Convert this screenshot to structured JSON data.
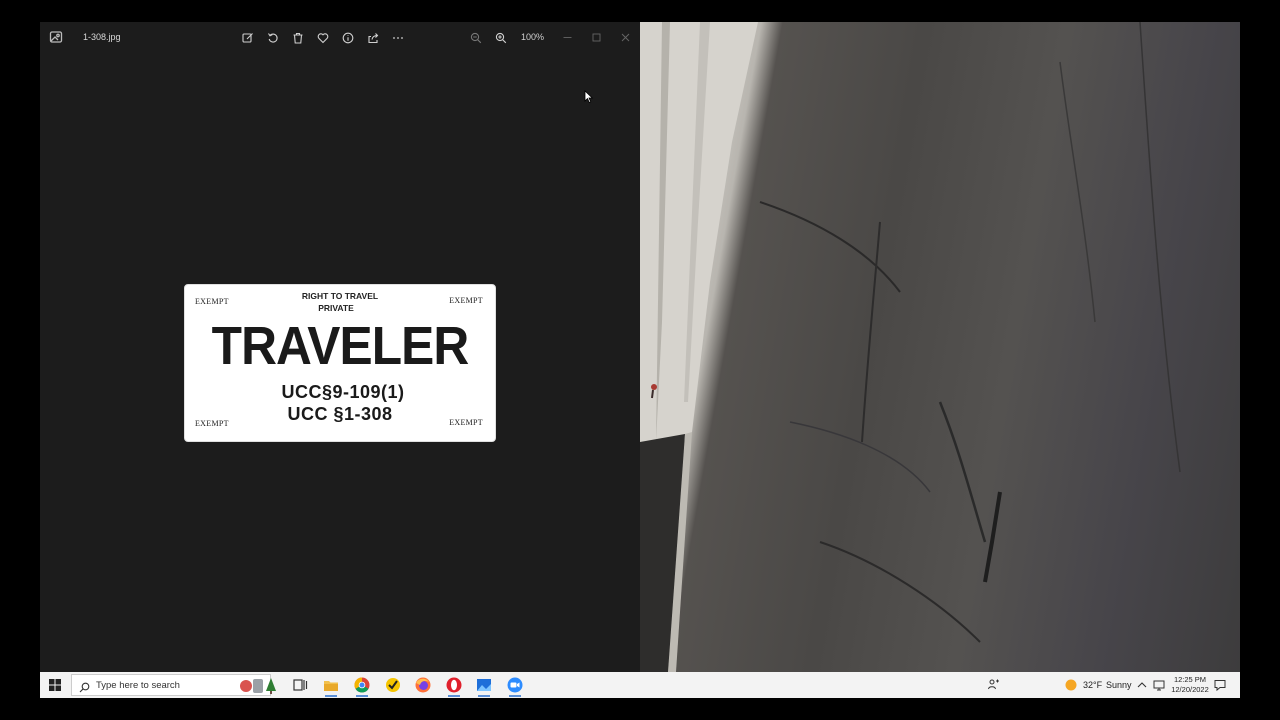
{
  "viewer": {
    "file_name": "1-308.jpg",
    "zoom_level": "100%"
  },
  "plate": {
    "exempt_top_left": "EXEMPT",
    "exempt_top_right": "EXEMPT",
    "exempt_bottom_left": "EXEMPT",
    "exempt_bottom_right": "EXEMPT",
    "line1": "RIGHT TO TRAVEL",
    "line2": "PRIVATE",
    "main": "TRAVELER",
    "code1": "UCC§9-109(1)",
    "code2": "UCC §1-308"
  },
  "taskbar": {
    "search_placeholder": "Type here to search",
    "weather_temp": "32°F",
    "weather_desc": "Sunny",
    "time": "12:25 PM",
    "date": "12/20/2022"
  },
  "colors": {
    "viewer_bg": "#1c1c1c",
    "taskbar_bg": "#f3f3f3",
    "accent": "#5b8fd6"
  }
}
